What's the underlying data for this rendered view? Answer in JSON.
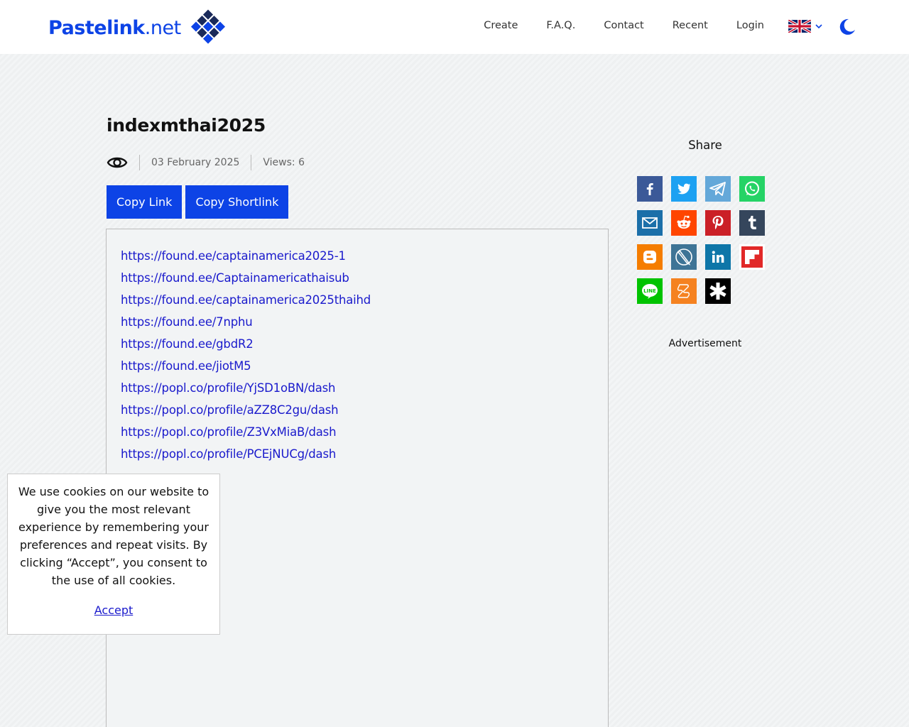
{
  "header": {
    "logo": {
      "brand": "Pastelink",
      "tld": ".net"
    },
    "nav": [
      {
        "label": "Create"
      },
      {
        "label": "F.A.Q."
      },
      {
        "label": "Contact"
      },
      {
        "label": "Recent"
      },
      {
        "label": "Login"
      }
    ],
    "language": {
      "icon": "uk-flag-icon",
      "selected": "en"
    },
    "theme_toggle_icon": "moon-icon"
  },
  "paste": {
    "title": "indexmthai2025",
    "visibility_icon": "eye-icon",
    "date": "03 February 2025",
    "views": "Views: 6",
    "copy_link_label": "Copy Link",
    "copy_shortlink_label": "Copy Shortlink",
    "links": [
      "https://found.ee/captainamerica2025-1",
      "https://found.ee/Captainamericathaisub",
      "https://found.ee/captainamerica2025thaihd",
      "https://found.ee/7nphu",
      "https://found.ee/gbdR2",
      "https://found.ee/jiotM5",
      "https://popl.co/profile/YjSD1oBN/dash",
      "https://popl.co/profile/aZZ8C2gu/dash",
      "https://popl.co/profile/Z3VxMiaB/dash",
      "https://popl.co/profile/PCEjNUCg/dash"
    ]
  },
  "sidebar": {
    "share_title": "Share",
    "share_icons": [
      {
        "name": "facebook-icon",
        "color": "#3b5998"
      },
      {
        "name": "twitter-icon",
        "color": "#1da1f2"
      },
      {
        "name": "telegram-icon",
        "color": "#64a8d9"
      },
      {
        "name": "whatsapp-icon",
        "color": "#25d366"
      },
      {
        "name": "email-icon",
        "color": "#1b6fa9"
      },
      {
        "name": "reddit-icon",
        "color": "#ff4500"
      },
      {
        "name": "pinterest-icon",
        "color": "#cb2027"
      },
      {
        "name": "tumblr-icon",
        "color": "#35465c"
      },
      {
        "name": "blogger-icon",
        "color": "#f57d00"
      },
      {
        "name": "livejournal-icon",
        "color": "#3e7496"
      },
      {
        "name": "linkedin-icon",
        "color": "#0e76a8"
      },
      {
        "name": "flipboard-icon",
        "color": "#e12828"
      },
      {
        "name": "line-icon",
        "color": "#00c300"
      },
      {
        "name": "ok-icon",
        "color": "#f58220"
      },
      {
        "name": "asterisk-icon",
        "color": "#000000"
      }
    ],
    "advertisement_label": "Advertisement"
  },
  "cookie": {
    "message": "We use cookies on our website to give you the most relevant experience by remembering your preferences and repeat visits. By clicking “Accept”, you consent to the use of all cookies.",
    "accept_label": "Accept"
  },
  "colors": {
    "accent": "#0d43e6",
    "link": "#1a1acc"
  }
}
